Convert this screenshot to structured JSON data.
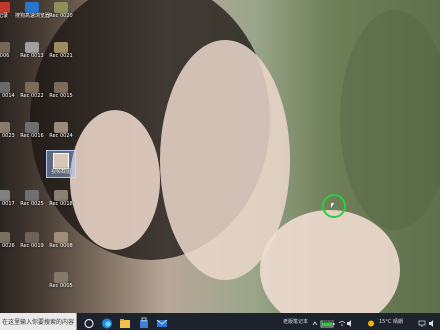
{
  "desktop": {
    "icons": [
      {
        "label": "记录",
        "color": "#c0392b"
      },
      {
        "label": "搜狗高速浏览器",
        "color": "#2a74c9"
      },
      {
        "label": "Rec 0020",
        "color": "#8e8e5a"
      },
      {
        "label": "0006",
        "color": "#776655"
      },
      {
        "label": "Rec 0013",
        "color": "#a0a0a0"
      },
      {
        "label": "Rec 0021",
        "color": "#9b8b5f"
      },
      {
        "label": "Rec 0014",
        "color": "#6a6a6a"
      },
      {
        "label": "Rec 0022",
        "color": "#7a6a5a"
      },
      {
        "label": "Rec 0015",
        "color": "#7a6a5a"
      },
      {
        "label": "Rec 0023",
        "color": "#8a7a6a"
      },
      {
        "label": "Rec 0016",
        "color": "#6e6e6e"
      },
      {
        "label": "Rec 0024",
        "color": "#9a8a7a"
      },
      {
        "label": "Rec 0017",
        "color": "#808080"
      },
      {
        "label": "Rec 0025",
        "color": "#707070"
      },
      {
        "label": "Rec 0018",
        "color": "#8a7f70"
      },
      {
        "label": "Rec 0026",
        "color": "#7a7060"
      },
      {
        "label": "Rec 0019",
        "color": "#6e6258"
      },
      {
        "label": "Rec 0008",
        "color": "#a08c78"
      },
      {
        "label": "Rec 0005",
        "color": "#86786a"
      }
    ],
    "selected_file_label": "视频截图"
  },
  "taskbar": {
    "search_placeholder": "在这里输入你要搜索的内容",
    "tray_app_label": "老版笔记本",
    "battery_text": "100%",
    "weather_text": "15°C 晴朗",
    "accent_color": "#2ecc40"
  }
}
